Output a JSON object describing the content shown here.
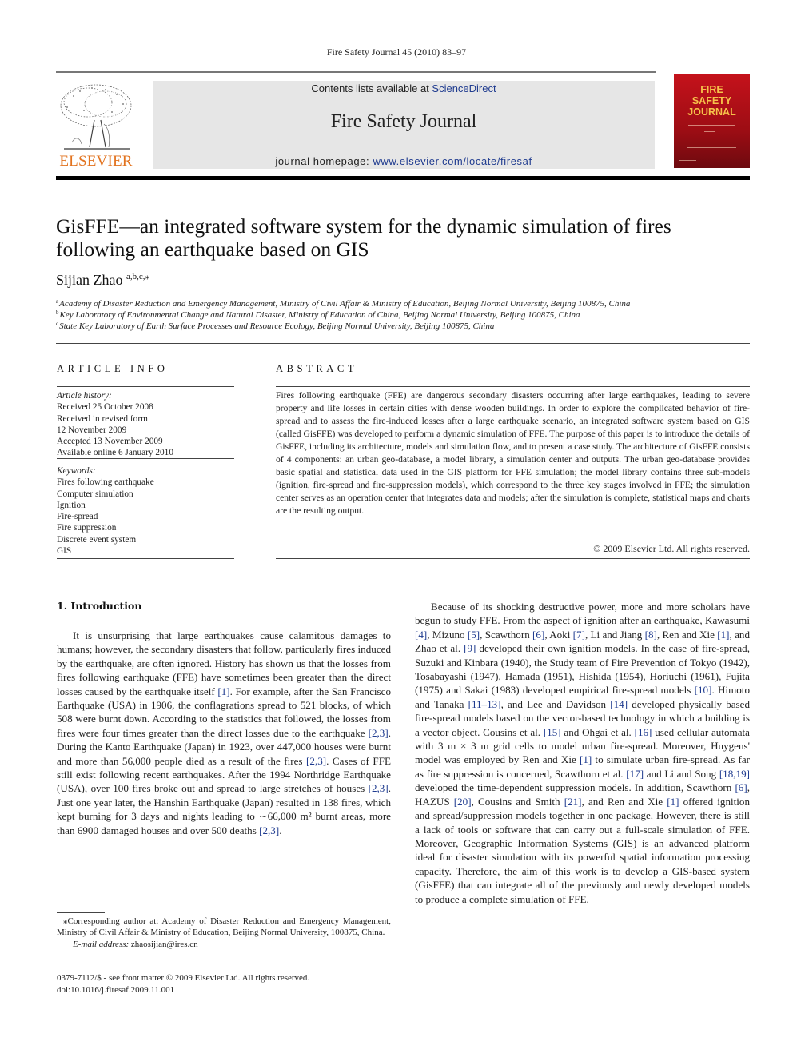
{
  "header": {
    "running_head": "Fire Safety Journal 45 (2010) 83–97",
    "publisher_logo": "ELSEVIER",
    "contents_prefix": "Contents lists available at ",
    "contents_link": "ScienceDirect",
    "journal_name": "Fire Safety Journal",
    "homepage_prefix": "journal homepage: ",
    "homepage_link": "www.elsevier.com/locate/firesaf",
    "cover_title_lines": [
      "FIRE",
      "SAFETY",
      "JOURNAL"
    ],
    "colors": {
      "elsevier_orange": "#e2731f",
      "link_blue": "#1f3b8f",
      "cover_red": "#c5121b",
      "cover_title": "#f6c24a",
      "masthead_bg": "#e6e6e6"
    }
  },
  "article": {
    "title": "GisFFE—an integrated software system for the dynamic simulation of fires following an earthquake based on GIS",
    "author": "Sijian Zhao",
    "author_sup": "a,b,c,",
    "author_star": "⁎",
    "affiliations": [
      {
        "mark": "a",
        "text": "Academy of Disaster Reduction and Emergency Management, Ministry of Civil Affair & Ministry of Education, Beijing Normal University, Beijing 100875, China"
      },
      {
        "mark": "b",
        "text": "Key Laboratory of Environmental Change and Natural Disaster, Ministry of Education of China, Beijing Normal University, Beijing 100875, China"
      },
      {
        "mark": "c",
        "text": "State Key Laboratory of Earth Surface Processes and Resource Ecology, Beijing Normal University, Beijing 100875, China"
      }
    ]
  },
  "article_info": {
    "heading": "ARTICLE INFO",
    "history_label": "Article history:",
    "history": [
      "Received 25 October 2008",
      "Received in revised form",
      "12 November 2009",
      "Accepted 13 November 2009",
      "Available online 6 January 2010"
    ],
    "keywords_label": "Keywords:",
    "keywords": [
      "Fires following earthquake",
      "Computer simulation",
      "Ignition",
      "Fire-spread",
      "Fire suppression",
      "Discrete event system",
      "GIS"
    ]
  },
  "abstract": {
    "heading": "ABSTRACT",
    "text": "Fires following earthquake (FFE) are dangerous secondary disasters occurring after large earthquakes, leading to severe property and life losses in certain cities with dense wooden buildings. In order to explore the complicated behavior of fire-spread and to assess the fire-induced losses after a large earthquake scenario, an integrated software system based on GIS (called GisFFE) was developed to perform a dynamic simulation of FFE. The purpose of this paper is to introduce the details of GisFFE, including its architecture, models and simulation flow, and to present a case study. The architecture of GisFFE consists of 4 components: an urban geo-database, a model library, a simulation center and outputs. The urban geo-database provides basic spatial and statistical data used in the GIS platform for FFE simulation; the model library contains three sub-models (ignition, fire-spread and fire-suppression models), which correspond to the three key stages involved in FFE; the simulation center serves as an operation center that integrates data and models; after the simulation is complete, statistical maps and charts are the resulting output.",
    "copyright": "© 2009 Elsevier Ltd. All rights reserved."
  },
  "introduction": {
    "heading": "1.  Introduction",
    "para1": [
      {
        "t": "It is unsurprising that large earthquakes cause calamitous damages to humans; however, the secondary disasters that follow, particularly fires induced by the earthquake, are often ignored. History has shown us that the losses from fires following earthquake (FFE) have sometimes been greater than the direct losses caused by the earthquake itself "
      },
      {
        "ref": "[1]"
      },
      {
        "t": ". For example, after the San Francisco Earthquake (USA) in 1906, the conflagrations spread to 521 blocks, of which 508 were burnt down. According to the statistics that followed, the losses from fires were four times greater than the direct losses due to the earthquake "
      },
      {
        "ref": "[2,3]"
      },
      {
        "t": ". During the Kanto Earthquake (Japan) in 1923, over 447,000 houses were burnt and more than 56,000 people died as a result of the fires "
      },
      {
        "ref": "[2,3]"
      },
      {
        "t": ". Cases of FFE still exist following recent earthquakes. After the 1994 Northridge Earthquake (USA), over 100 fires broke out and spread to large stretches of houses "
      },
      {
        "ref": "[2,3]"
      },
      {
        "t": ". Just one year later, the Hanshin Earthquake (Japan) resulted in 138 fires, which kept burning for 3 days and nights leading to ∼66,000 m² burnt areas, more than 6900 damaged houses and over 500 deaths "
      },
      {
        "ref": "[2,3]"
      },
      {
        "t": "."
      }
    ],
    "para2": [
      {
        "t": "Because of its shocking destructive power, more and more scholars have begun to study FFE. From the aspect of ignition after an earthquake, Kawasumi "
      },
      {
        "ref": "[4]"
      },
      {
        "t": ", Mizuno "
      },
      {
        "ref": "[5]"
      },
      {
        "t": ", Scawthorn "
      },
      {
        "ref": "[6]"
      },
      {
        "t": ", Aoki "
      },
      {
        "ref": "[7]"
      },
      {
        "t": ", Li and Jiang "
      },
      {
        "ref": "[8]"
      },
      {
        "t": ", Ren and Xie "
      },
      {
        "ref": "[1]"
      },
      {
        "t": ", and Zhao et al. "
      },
      {
        "ref": "[9]"
      },
      {
        "t": " developed their own ignition models. In the case of fire-spread, Suzuki and Kinbara (1940), the Study team of Fire Prevention of Tokyo (1942), Tosabayashi (1947), Hamada (1951), Hishida (1954), Horiuchi (1961), Fujita (1975) and Sakai (1983) developed empirical fire-spread models "
      },
      {
        "ref": "[10]"
      },
      {
        "t": ". Himoto and Tanaka "
      },
      {
        "ref": "[11–13]"
      },
      {
        "t": ", and Lee and Davidson "
      },
      {
        "ref": "[14]"
      },
      {
        "t": " developed physically based fire-spread models based on the vector-based technology in which a building is a vector object. Cousins et al. "
      },
      {
        "ref": "[15]"
      },
      {
        "t": " and Ohgai et al. "
      },
      {
        "ref": "[16]"
      },
      {
        "t": " used cellular automata with 3 m × 3 m grid cells to model urban fire-spread. Moreover, Huygens' model was employed by Ren and Xie "
      },
      {
        "ref": "[1]"
      },
      {
        "t": " to simulate urban fire-spread. As far as fire suppression is concerned, Scawthorn et al. "
      },
      {
        "ref": "[17]"
      },
      {
        "t": " and Li and Song "
      },
      {
        "ref": "[18,19]"
      },
      {
        "t": " developed the time-dependent suppression models. In addition, Scawthorn "
      },
      {
        "ref": "[6]"
      },
      {
        "t": ", HAZUS "
      },
      {
        "ref": "[20]"
      },
      {
        "t": ", Cousins and Smith "
      },
      {
        "ref": "[21]"
      },
      {
        "t": ", and Ren and Xie "
      },
      {
        "ref": "[1]"
      },
      {
        "t": " offered ignition and spread/suppression models together in one package. However, there is still a lack of tools or software that can carry out a full-scale simulation of FFE. Moreover, Geographic Information Systems (GIS) is an advanced platform ideal for disaster simulation with its powerful spatial information processing capacity. Therefore, the aim of this work is to develop a GIS-based system (GisFFE) that can integrate all of the previously and newly developed models to produce a complete simulation of FFE."
      }
    ]
  },
  "footnote": {
    "star": "⁎",
    "text": "Corresponding author at: Academy of Disaster Reduction and Emergency Management, Ministry of Civil Affair & Ministry of Education, Beijing Normal University, 100875, China.",
    "email_label": "E-mail address:",
    "email": "zhaosijian@ires.cn"
  },
  "issn": {
    "line1": "0379-7112/$ - see front matter © 2009 Elsevier Ltd. All rights reserved.",
    "doi": "doi:10.1016/j.firesaf.2009.11.001"
  }
}
